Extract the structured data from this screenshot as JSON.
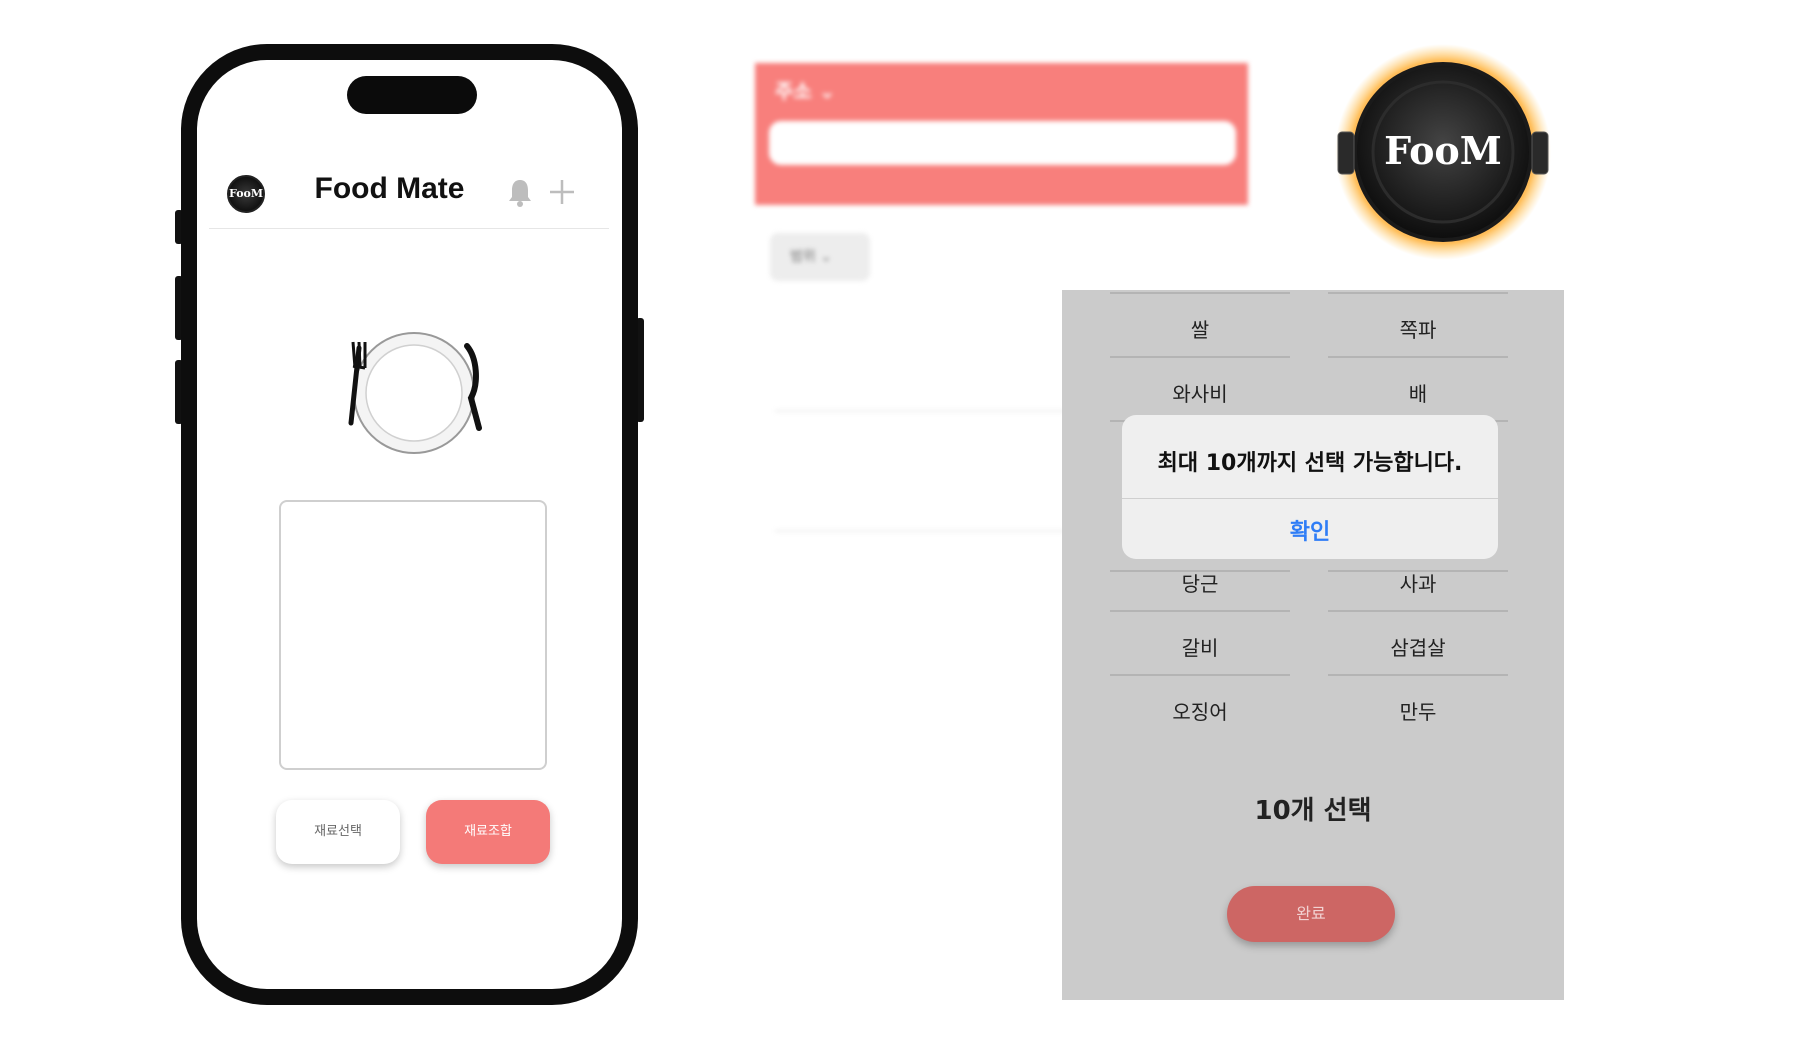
{
  "phone": {
    "header": {
      "logo_text": "FooM",
      "title": "Food Mate",
      "bell_icon": "bell-icon",
      "plus_icon": "plus-icon"
    },
    "plate_logo_text": "FooM",
    "buttons": {
      "select_label": "재료선택",
      "combine_label": "재료조합"
    },
    "accent_color": "#f47a78"
  },
  "blurred_screen": {
    "address_label": "주소",
    "search_placeholder": "",
    "range_label": "범위",
    "distance_label": "",
    "posts": [
      {
        "title": "",
        "lines": [
          "",
          ""
        ]
      },
      {
        "title": "",
        "lines": [
          "",
          ""
        ]
      }
    ],
    "header_color": "#f87f7c"
  },
  "fire_logo_text": "FooM",
  "ingredient_screen": {
    "items": [
      "쌀",
      "쪽파",
      "와사비",
      "배",
      "당근",
      "사과",
      "갈비",
      "삼겹살",
      "오징어",
      "만두"
    ],
    "alert": {
      "message": "최대 10개까지 선택 가능합니다.",
      "confirm_label": "확인"
    },
    "count_text": "10개 선택",
    "done_label": "완료",
    "confirm_color": "#2f7df6"
  }
}
